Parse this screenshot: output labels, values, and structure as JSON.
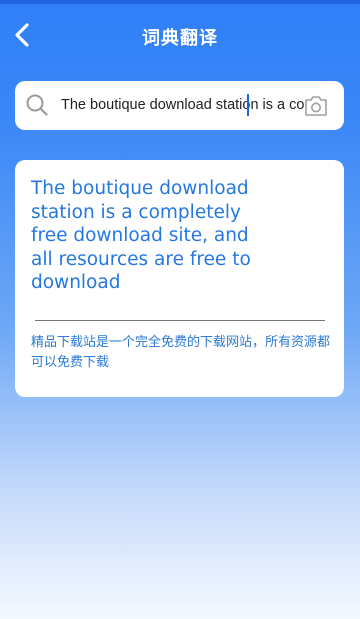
{
  "header": {
    "title": "词典翻译",
    "back_icon": "chevron-left-icon"
  },
  "search": {
    "value": "The boutique download station is a co",
    "search_icon": "search-icon",
    "camera_icon": "camera-icon"
  },
  "result": {
    "source_text": "The boutique download station is a completely free download site, and all resources are free to download",
    "translation": "精品下载站是一个完全免费的下载网站，所有资源都可以免费下载"
  },
  "colors": {
    "accent": "#2f7ff7",
    "text_blue": "#2478e0"
  }
}
